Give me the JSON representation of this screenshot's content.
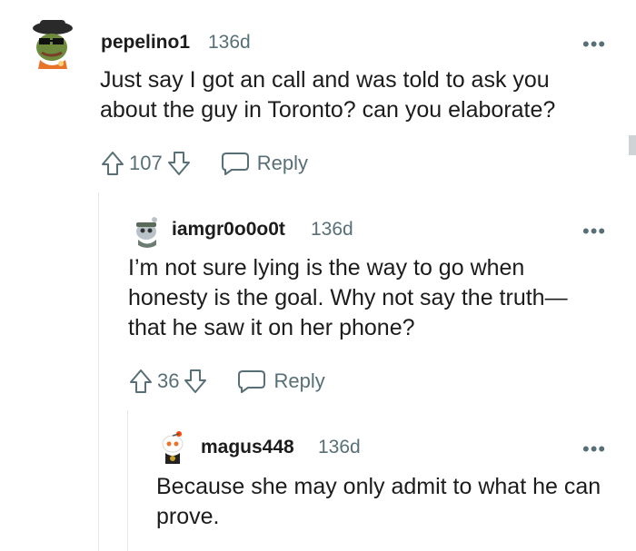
{
  "comments": [
    {
      "username": "pepelino1",
      "age": "136d",
      "more": "•••",
      "body": "Just say I got an call and was told to ask you about the guy in Toronto? can you elaborate?",
      "votes": "107",
      "reply_label": "Reply",
      "avatar_icon": "avatar-pepe-icon"
    },
    {
      "username": "iamgr0o0o0t",
      "age": "136d",
      "more": "•••",
      "body": "I’m not sure lying is the way to go when honesty is the goal. Why not say the truth—that he saw it on her phone?",
      "votes": "36",
      "reply_label": "Reply",
      "avatar_icon": "avatar-snoo-icon"
    },
    {
      "username": "magus448",
      "age": "136d",
      "more": "•••",
      "body": "Because she may only admit to what he can prove.",
      "avatar_icon": "avatar-snoo-icon"
    }
  ],
  "colors": {
    "text": "#1c1c1c",
    "meta": "#576f76",
    "thread_line": "#e6e8ea"
  }
}
